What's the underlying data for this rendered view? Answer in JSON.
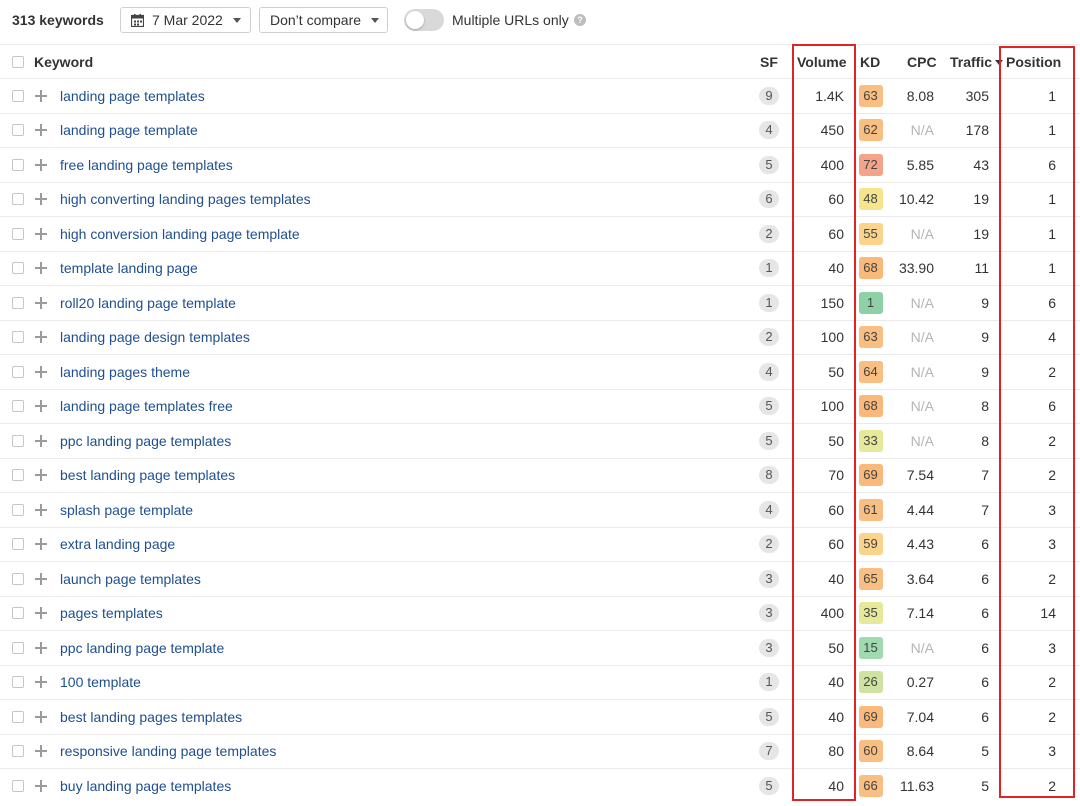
{
  "toolbar": {
    "keyword_count": "313 keywords",
    "date_label": "7 Mar 2022",
    "compare_label": "Don’t compare",
    "toggle_label": "Multiple URLs only",
    "help_symbol": "?"
  },
  "columns": {
    "keyword": "Keyword",
    "sf": "SF",
    "volume": "Volume",
    "kd": "KD",
    "cpc": "CPC",
    "traffic": "Traffic",
    "position": "Position"
  },
  "kd_colors": {
    "green": "#8fd1a6",
    "lightgreen": "#cfe3a0",
    "yellow": "#f6e58d",
    "lightorange": "#fbd38d",
    "orange": "#f8b97a",
    "red": "#f4a48b"
  },
  "rows": [
    {
      "keyword": "landing page templates",
      "sf": "9",
      "volume": "1.4K",
      "kd": "63",
      "kd_color": "#f8be82",
      "cpc": "8.08",
      "traffic": "305",
      "position": "1"
    },
    {
      "keyword": "landing page template",
      "sf": "4",
      "volume": "450",
      "kd": "62",
      "kd_color": "#f8be82",
      "cpc": "N/A",
      "traffic": "178",
      "position": "1"
    },
    {
      "keyword": "free landing page templates",
      "sf": "5",
      "volume": "400",
      "kd": "72",
      "kd_color": "#f4a48b",
      "cpc": "5.85",
      "traffic": "43",
      "position": "6"
    },
    {
      "keyword": "high converting landing pages templates",
      "sf": "6",
      "volume": "60",
      "kd": "48",
      "kd_color": "#f6e58d",
      "cpc": "10.42",
      "traffic": "19",
      "position": "1"
    },
    {
      "keyword": "high conversion landing page template",
      "sf": "2",
      "volume": "60",
      "kd": "55",
      "kd_color": "#fbd38d",
      "cpc": "N/A",
      "traffic": "19",
      "position": "1"
    },
    {
      "keyword": "template landing page",
      "sf": "1",
      "volume": "40",
      "kd": "68",
      "kd_color": "#f8b97a",
      "cpc": "33.90",
      "traffic": "11",
      "position": "1"
    },
    {
      "keyword": "roll20 landing page template",
      "sf": "1",
      "volume": "150",
      "kd": "1",
      "kd_color": "#8fd1a6",
      "cpc": "N/A",
      "traffic": "9",
      "position": "6"
    },
    {
      "keyword": "landing page design templates",
      "sf": "2",
      "volume": "100",
      "kd": "63",
      "kd_color": "#f8be82",
      "cpc": "N/A",
      "traffic": "9",
      "position": "4"
    },
    {
      "keyword": "landing pages theme",
      "sf": "4",
      "volume": "50",
      "kd": "64",
      "kd_color": "#f8be82",
      "cpc": "N/A",
      "traffic": "9",
      "position": "2"
    },
    {
      "keyword": "landing page templates free",
      "sf": "5",
      "volume": "100",
      "kd": "68",
      "kd_color": "#f8b97a",
      "cpc": "N/A",
      "traffic": "8",
      "position": "6"
    },
    {
      "keyword": "ppc landing page templates",
      "sf": "5",
      "volume": "50",
      "kd": "33",
      "kd_color": "#e6e89a",
      "cpc": "N/A",
      "traffic": "8",
      "position": "2"
    },
    {
      "keyword": "best landing page templates",
      "sf": "8",
      "volume": "70",
      "kd": "69",
      "kd_color": "#f8b97a",
      "cpc": "7.54",
      "traffic": "7",
      "position": "2"
    },
    {
      "keyword": "splash page template",
      "sf": "4",
      "volume": "60",
      "kd": "61",
      "kd_color": "#f8be82",
      "cpc": "4.44",
      "traffic": "7",
      "position": "3"
    },
    {
      "keyword": "extra landing page",
      "sf": "2",
      "volume": "60",
      "kd": "59",
      "kd_color": "#fbd38d",
      "cpc": "4.43",
      "traffic": "6",
      "position": "3"
    },
    {
      "keyword": "launch page templates",
      "sf": "3",
      "volume": "40",
      "kd": "65",
      "kd_color": "#f8be82",
      "cpc": "3.64",
      "traffic": "6",
      "position": "2"
    },
    {
      "keyword": "pages templates",
      "sf": "3",
      "volume": "400",
      "kd": "35",
      "kd_color": "#e6e89a",
      "cpc": "7.14",
      "traffic": "6",
      "position": "14"
    },
    {
      "keyword": "ppc landing page template",
      "sf": "3",
      "volume": "50",
      "kd": "15",
      "kd_color": "#9fd9b0",
      "cpc": "N/A",
      "traffic": "6",
      "position": "3"
    },
    {
      "keyword": "100 template",
      "sf": "1",
      "volume": "40",
      "kd": "26",
      "kd_color": "#cfe3a0",
      "cpc": "0.27",
      "traffic": "6",
      "position": "2"
    },
    {
      "keyword": "best landing pages templates",
      "sf": "5",
      "volume": "40",
      "kd": "69",
      "kd_color": "#f8b97a",
      "cpc": "7.04",
      "traffic": "6",
      "position": "2"
    },
    {
      "keyword": "responsive landing page templates",
      "sf": "7",
      "volume": "80",
      "kd": "60",
      "kd_color": "#f8be82",
      "cpc": "8.64",
      "traffic": "5",
      "position": "3"
    },
    {
      "keyword": "buy landing page templates",
      "sf": "5",
      "volume": "40",
      "kd": "66",
      "kd_color": "#f8be82",
      "cpc": "11.63",
      "traffic": "5",
      "position": "2"
    }
  ],
  "highlight_color": "#e02424"
}
